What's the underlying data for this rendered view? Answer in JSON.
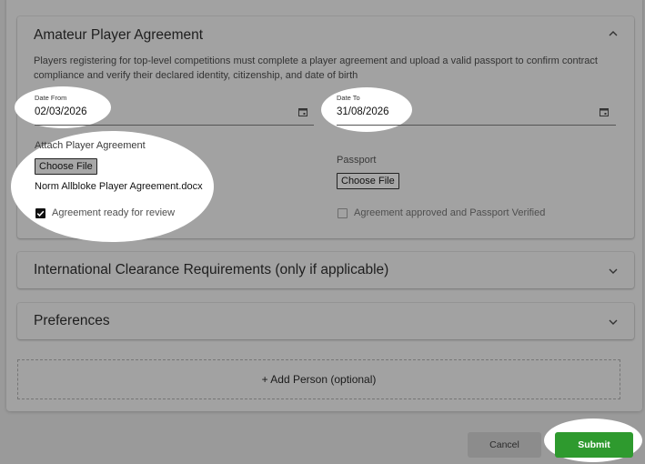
{
  "player_agreement": {
    "title": "Amateur Player Agreement",
    "description": "Players registering for top-level competitions must complete a player agreement and upload a valid passport to confirm contract compliance and verify their declared identity, citizenship, and date of birth",
    "date_from": {
      "label": "Date From",
      "value": "02/03/2026"
    },
    "date_to": {
      "label": "Date To",
      "value": "31/08/2026"
    },
    "attach_agreement": {
      "label": "Attach Player Agreement",
      "button_label": "Choose File",
      "file_name": "Norm Allbloke Player Agreement.docx"
    },
    "passport": {
      "label": "Passport",
      "button_label": "Choose File"
    },
    "checkbox_ready": {
      "label": "Agreement ready for review",
      "checked": true
    },
    "checkbox_approved": {
      "label": "Agreement approved and Passport Verified",
      "checked": false
    }
  },
  "sections": {
    "international_clearance": {
      "title": "International Clearance Requirements (only if applicable)"
    },
    "preferences": {
      "title": "Preferences"
    }
  },
  "add_person": {
    "label": "+ Add Person (optional)"
  },
  "actions": {
    "cancel_label": "Cancel",
    "submit_label": "Submit"
  },
  "colors": {
    "submit_bg": "#2e9a2e",
    "cancel_bg": "#8c8c8c",
    "overlay_bg": "#9a9a9a",
    "highlight": "#ffffff"
  },
  "icons": {
    "expand": "chevron-up-icon",
    "collapse": "chevron-down-icon",
    "calendar": "calendar-icon",
    "check": "checkmark-icon"
  }
}
